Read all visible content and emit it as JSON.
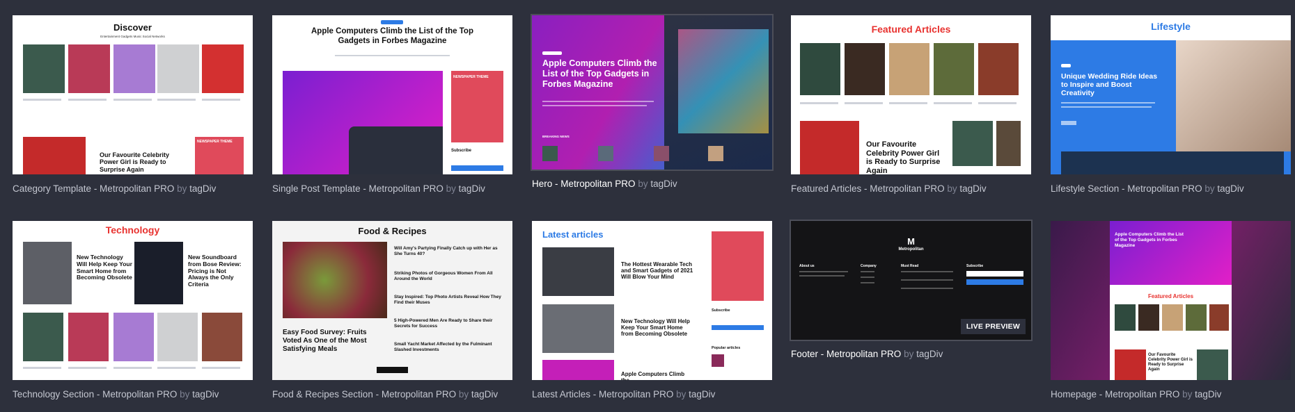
{
  "byline": {
    "by": "by",
    "author": "tagDiv"
  },
  "live_preview_label": "LIVE PREVIEW",
  "colors": {
    "background": "#2d303c",
    "accent_red": "#e8322f",
    "accent_blue": "#2d7be5",
    "accent_green": "#3ec28f"
  },
  "cards": [
    {
      "title": "Category Template - Metropolitan PRO",
      "heading": "Discover",
      "tags": "Entertainment   Gadgets   Music   Social Networks",
      "feature": "Our Favourite Celebrity Power Girl is Ready to Surprise Again",
      "badge": "NEWSPAPER THEME"
    },
    {
      "title": "Single Post Template - Metropolitan PRO",
      "heading": "Apple Computers Climb the List of the Top Gadgets in Forbes Magazine",
      "subscribe": "Subscribe",
      "badge": "NEWSPAPER THEME"
    },
    {
      "title": "Hero - Metropolitan PRO",
      "heading": "Apple Computers Climb the List of the Top Gadgets in Forbes Magazine",
      "label": "BREAKING NEWS"
    },
    {
      "title": "Featured Articles - Metropolitan PRO",
      "heading": "Featured Articles",
      "feature": "Our Favourite Celebrity Power Girl is Ready to Surprise Again"
    },
    {
      "title": "Lifestyle Section - Metropolitan PRO",
      "heading": "Lifestyle",
      "feature": "Unique Wedding Ride Ideas to Inspire and Boost Creativity"
    },
    {
      "title": "Technology Section - Metropolitan PRO",
      "heading": "Technology",
      "left": "New Technology Will Help Keep Your Smart Home from Becoming Obsolete",
      "right": "New Soundboard from Bose Review: Pricing is Not Always the Only Criteria"
    },
    {
      "title": "Food & Recipes Section - Metropolitan PRO",
      "heading": "Food & Recipes",
      "feature": "Easy Food Survey: Fruits Voted As One of the Most Satisfying Meals",
      "items": [
        "Will Amy's Partying Finally Catch up with Her as She Turns 40?",
        "Striking Photos of Gorgeous Women From All Around the World",
        "Stay Inspired: Top Photo Artists Reveal How They Find their Muses",
        "5 High-Powered Men Are Ready to Share their Secrets for Success",
        "Small Yacht Market Affected by the Fulminant Slashed Investments"
      ]
    },
    {
      "title": "Latest Articles - Metropolitan PRO",
      "heading": "Latest articles",
      "items": [
        "The Hottest Wearable Tech and Smart Gadgets of 2021 Will Blow Your Mind",
        "New Technology Will Help Keep Your Smart Home from Becoming Obsolete",
        "Apple Computers Climb the"
      ],
      "subscribe": "Subscribe",
      "popular": "Popular articles"
    },
    {
      "title": "Footer - Metropolitan PRO",
      "logo": "Metropolitan",
      "cols": [
        "About us",
        "Company",
        "Must Read",
        "Subscribe"
      ]
    },
    {
      "title": "Homepage - Metropolitan PRO",
      "heading": "Apple Computers Climb the List of the Top Gadgets in Forbes Magazine",
      "section": "Featured Articles",
      "feature": "Our Favourite Celebrity Power Girl is Ready to Surprise Again"
    }
  ]
}
